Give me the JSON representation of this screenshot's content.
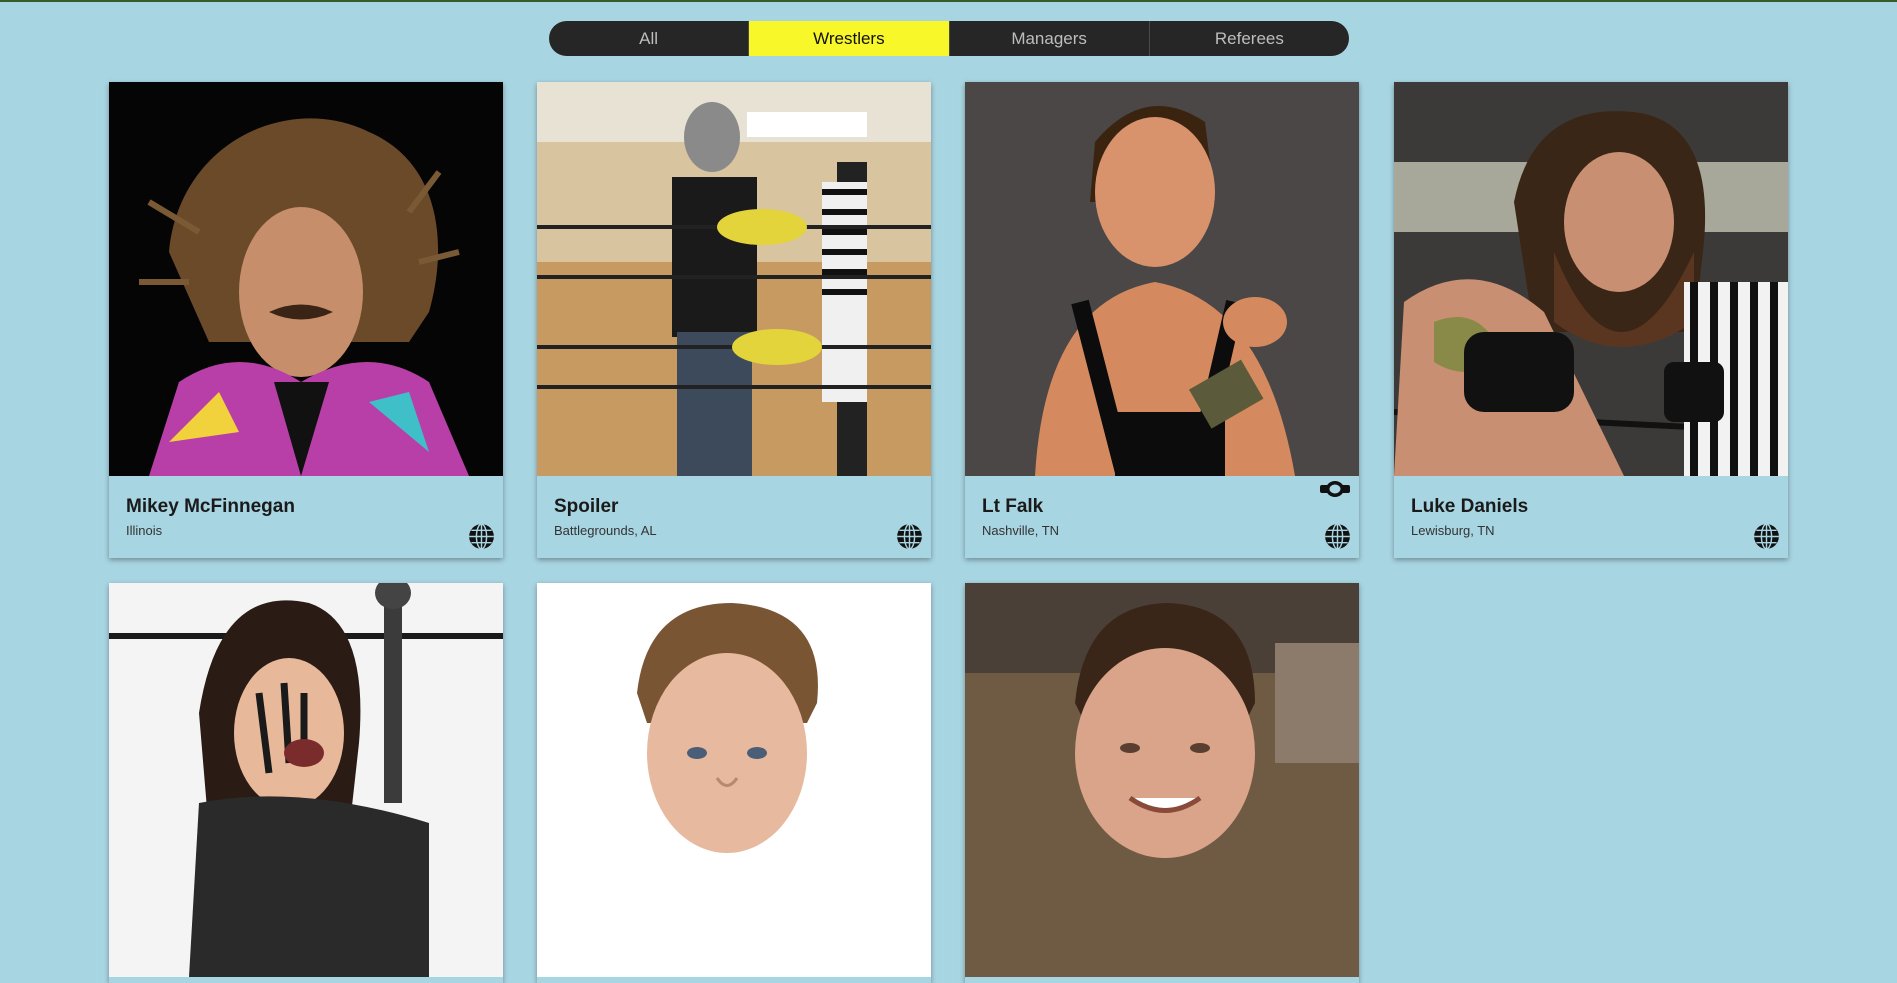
{
  "filter_tabs": [
    {
      "label": "All",
      "active": false
    },
    {
      "label": "Wrestlers",
      "active": true
    },
    {
      "label": "Managers",
      "active": false
    },
    {
      "label": "Referees",
      "active": false
    }
  ],
  "roster": [
    {
      "name": "Mikey McFinnegan",
      "location": "Illinois",
      "champion": false
    },
    {
      "name": "Spoiler",
      "location": "Battlegrounds, AL",
      "champion": false
    },
    {
      "name": "Lt Falk",
      "location": "Nashville, TN",
      "champion": true
    },
    {
      "name": "Luke Daniels",
      "location": "Lewisburg, TN",
      "champion": false
    }
  ],
  "icons": {
    "website": "globe-icon",
    "title_holder": "championship-belt-icon"
  },
  "colors": {
    "background": "#a8d5e2",
    "tab_bar": "#262626",
    "tab_active": "#f8f72a"
  }
}
